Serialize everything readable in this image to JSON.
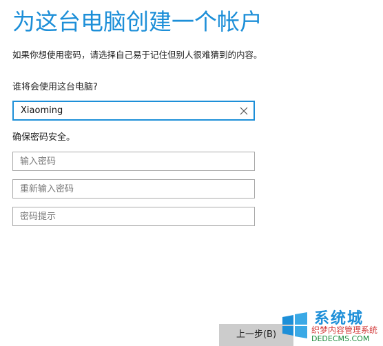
{
  "header": {
    "title": "为这台电脑创建一个帐户",
    "subtitle": "如果你想使用密码，请选择自己易于记住但别人很难猜到的内容。"
  },
  "form": {
    "username_label": "谁将会使用这台电脑?",
    "username_value": "Xiaoming",
    "security_label": "确保密码安全。",
    "password_placeholder": "输入密码",
    "confirm_placeholder": "重新输入密码",
    "hint_placeholder": "密码提示"
  },
  "footer": {
    "back_label": "上一步(B)"
  },
  "watermark": {
    "brand": "系统城",
    "line1": "织梦内容管理系统",
    "line2": "DEDECMS.COM"
  },
  "colors": {
    "accent": "#1d8fd8",
    "text": "#222222",
    "border": "#a9a9a9",
    "button_bg": "#cccccc"
  }
}
